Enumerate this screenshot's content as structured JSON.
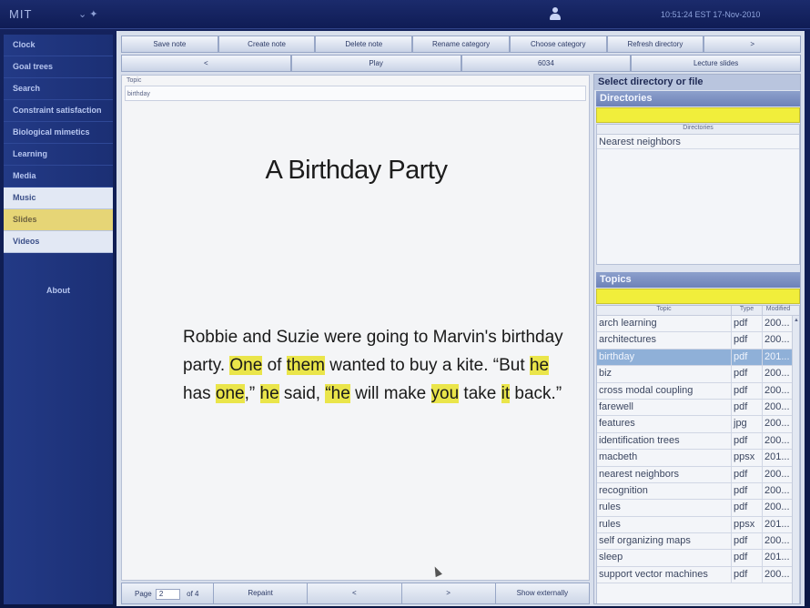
{
  "topbar": {
    "logo": "MIT",
    "menu": "⌄  ✦",
    "clock": "10:51:24 EST 17-Nov-2010"
  },
  "sidebar": {
    "items": [
      {
        "label": "Clock"
      },
      {
        "label": "Goal trees"
      },
      {
        "label": "Search"
      },
      {
        "label": "Constraint satisfaction"
      },
      {
        "label": "Biological mimetics"
      },
      {
        "label": "Learning"
      },
      {
        "label": "Media"
      },
      {
        "label": "Music"
      },
      {
        "label": "Slides"
      },
      {
        "label": "Videos"
      }
    ],
    "about": "About"
  },
  "toolbar1": [
    "Save note",
    "Create note",
    "Delete note",
    "Rename category",
    "Choose category",
    "Refresh directory",
    ">"
  ],
  "toolbar2": [
    "<",
    "Play",
    "6034",
    "Lecture slides"
  ],
  "slide": {
    "topic_label": "Topic",
    "topic_value": "birthday",
    "title": "A Birthday Party",
    "body": [
      {
        "t": "Robbie and Suzie were going to Marvin's",
        "h": false
      },
      {
        "t": " birthday party.  ",
        "h": false
      },
      {
        "t": "One",
        "h": true
      },
      {
        "t": " of ",
        "h": false
      },
      {
        "t": "them",
        "h": true
      },
      {
        "t": " wanted to buy a kite.  “But ",
        "h": false
      },
      {
        "t": "he",
        "h": true
      },
      {
        "t": " has ",
        "h": false
      },
      {
        "t": "one",
        "h": true
      },
      {
        "t": ",” ",
        "h": false
      },
      {
        "t": "he",
        "h": true
      },
      {
        "t": " said, ",
        "h": false
      },
      {
        "t": "“he",
        "h": true
      },
      {
        "t": " will make ",
        "h": false
      },
      {
        "t": "you",
        "h": true
      },
      {
        "t": " take ",
        "h": false
      },
      {
        "t": "it",
        "h": true
      },
      {
        "t": " back.”",
        "h": false
      }
    ]
  },
  "bottombar": {
    "page_label": "Page",
    "page_value": "2",
    "of_label": "of  4",
    "buttons": [
      "Repaint",
      "<",
      ">",
      "Show externally"
    ]
  },
  "right_panel": {
    "select_header": "Select directory or file",
    "directories_header": "Directories",
    "directories_col": "Directories",
    "directories": [
      "Nearest neighbors"
    ],
    "topics_header": "Topics",
    "topics_cols": [
      "Topic",
      "Type",
      "Modified"
    ],
    "topics": [
      {
        "topic": "arch learning",
        "type": "pdf",
        "mod": "200..."
      },
      {
        "topic": "architectures",
        "type": "pdf",
        "mod": "200..."
      },
      {
        "topic": "birthday",
        "type": "pdf",
        "mod": "201...",
        "selected": true
      },
      {
        "topic": "biz",
        "type": "pdf",
        "mod": "200..."
      },
      {
        "topic": "cross modal coupling",
        "type": "pdf",
        "mod": "200..."
      },
      {
        "topic": "farewell",
        "type": "pdf",
        "mod": "200..."
      },
      {
        "topic": "features",
        "type": "jpg",
        "mod": "200..."
      },
      {
        "topic": "identification trees",
        "type": "pdf",
        "mod": "200..."
      },
      {
        "topic": "macbeth",
        "type": "ppsx",
        "mod": "201..."
      },
      {
        "topic": "nearest neighbors",
        "type": "pdf",
        "mod": "200..."
      },
      {
        "topic": "recognition",
        "type": "pdf",
        "mod": "200..."
      },
      {
        "topic": "rules",
        "type": "pdf",
        "mod": "200..."
      },
      {
        "topic": "rules",
        "type": "ppsx",
        "mod": "201..."
      },
      {
        "topic": "self organizing maps",
        "type": "pdf",
        "mod": "200..."
      },
      {
        "topic": "sleep",
        "type": "pdf",
        "mod": "201..."
      },
      {
        "topic": "support vector machines",
        "type": "pdf",
        "mod": "200..."
      }
    ]
  }
}
